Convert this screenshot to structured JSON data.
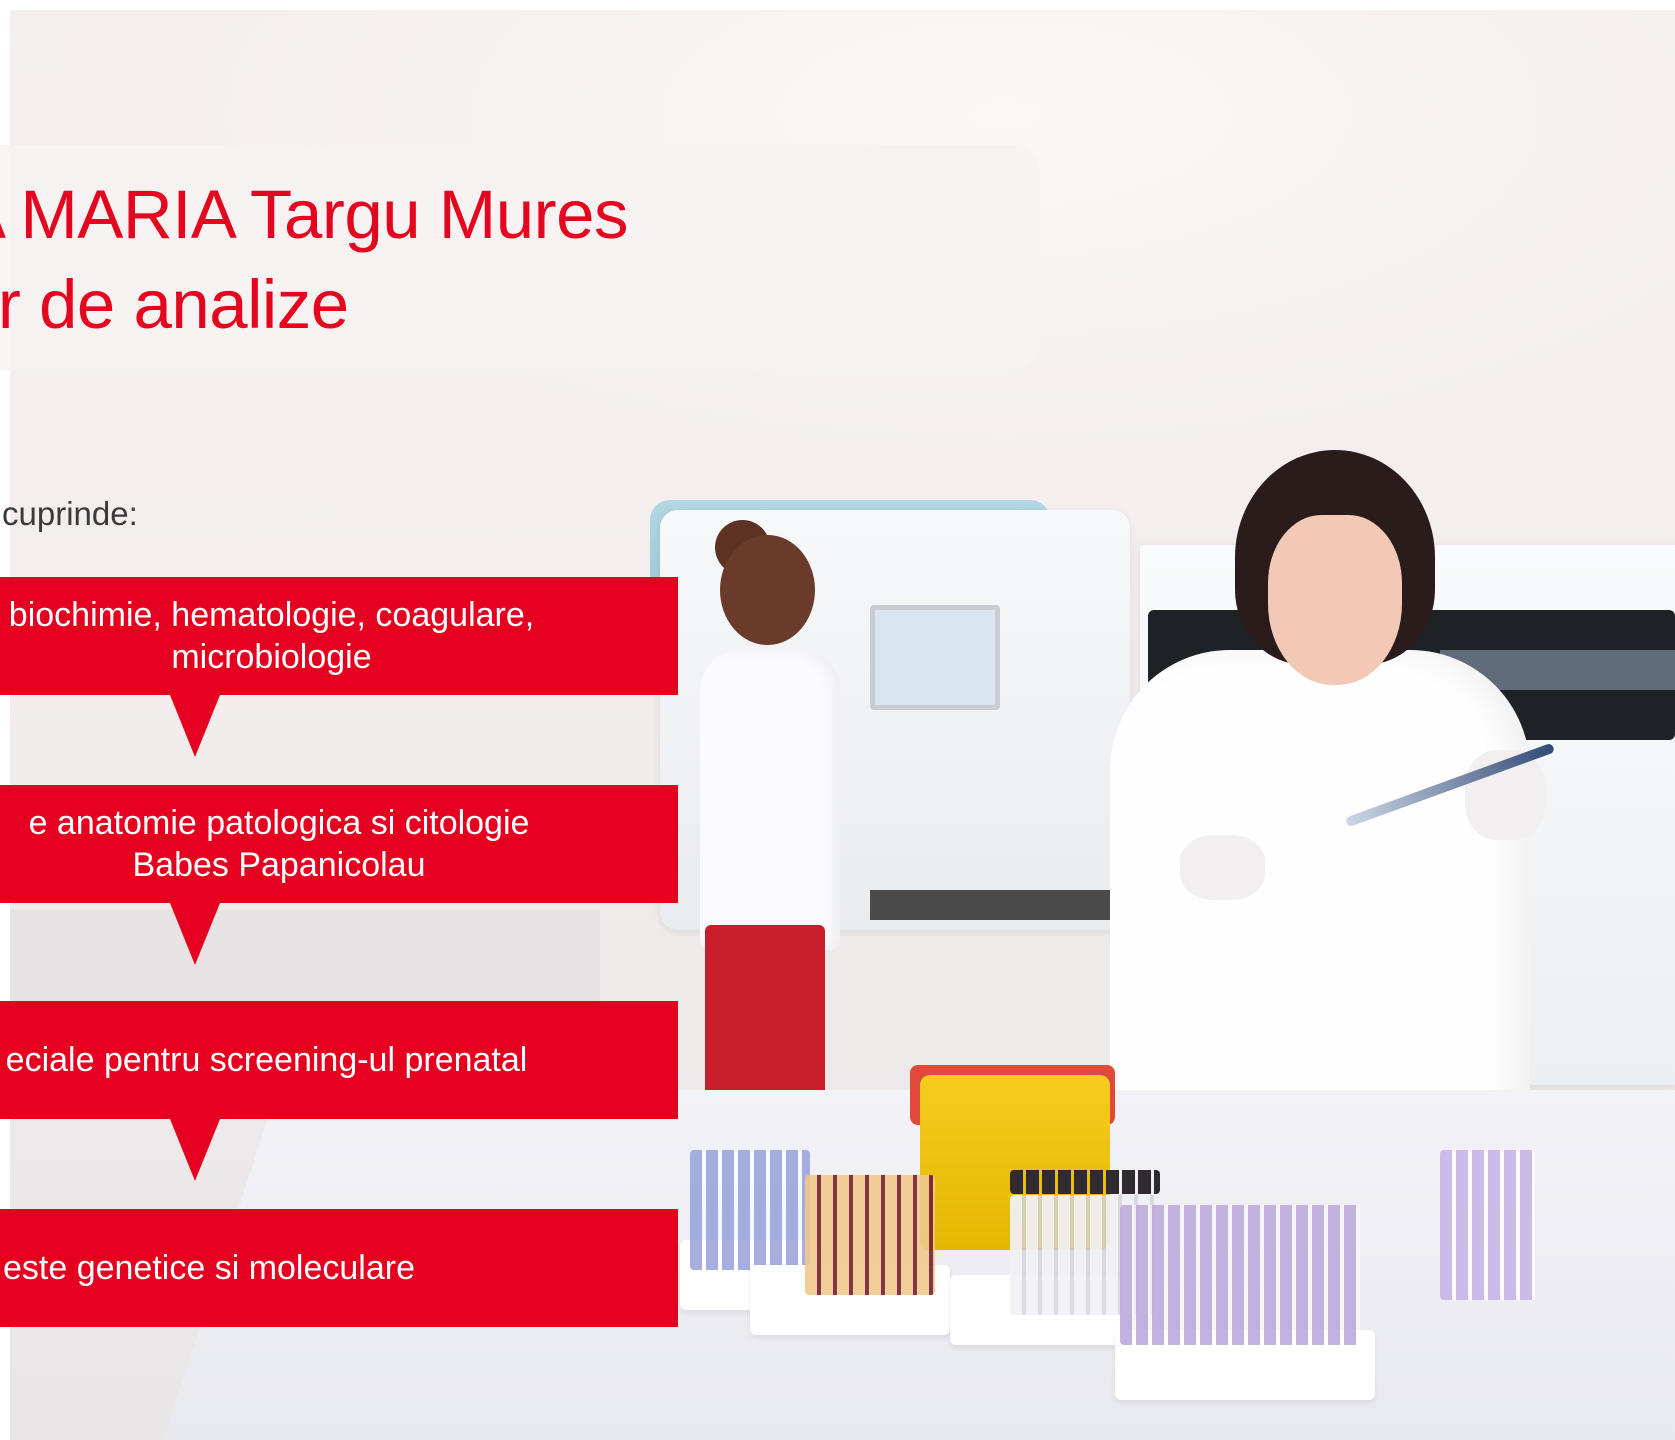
{
  "hero": {
    "title_line_1": "A MARIA Targu Mures",
    "title_line_2": "or de analize"
  },
  "intro_text": "cuprinde:",
  "callouts": [
    {
      "text": "biochimie, hematologie, coagulare,\nmicrobiologie"
    },
    {
      "text": "e anatomie patologica si citologie\nBabes Papanicolau"
    },
    {
      "text": "eciale pentru screening-ul prenatal"
    },
    {
      "text": "este genetice si moleculare"
    }
  ],
  "colors": {
    "brand_red": "#e6001f",
    "title_red": "#e4061e"
  }
}
